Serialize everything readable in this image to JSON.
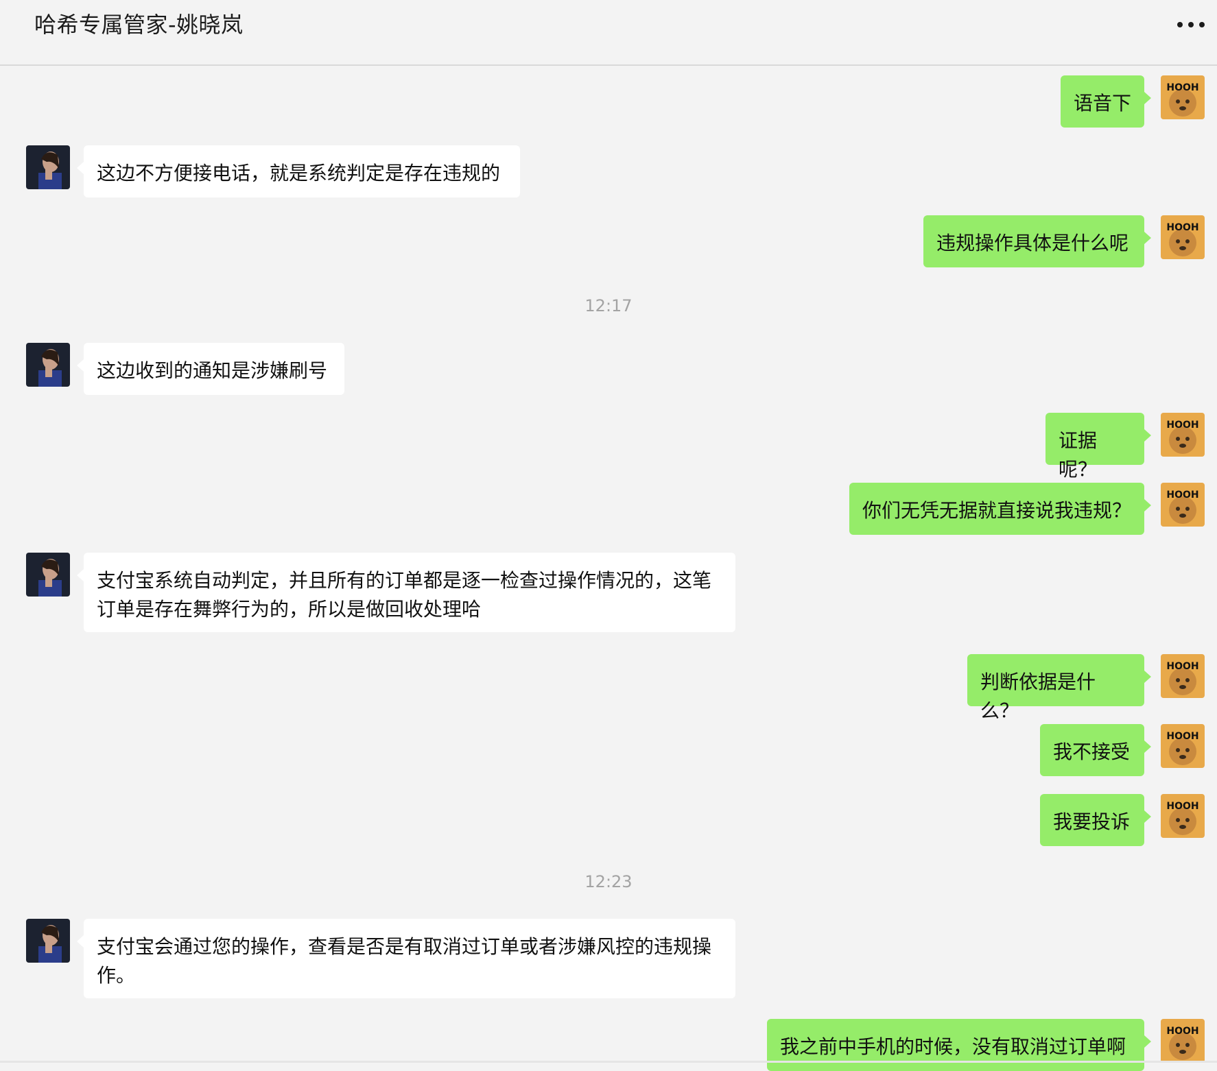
{
  "header": {
    "title": "哈希专属管家-姚晓岚"
  },
  "messages": [
    {
      "side": "out",
      "text": "语音下"
    },
    {
      "side": "in",
      "text": "这边不方便接电话，就是系统判定是存在违规的"
    },
    {
      "side": "out",
      "text": "违规操作具体是什么呢"
    },
    {
      "time": "12:17"
    },
    {
      "side": "in",
      "text": "这边收到的通知是涉嫌刷号"
    },
    {
      "side": "out",
      "text": "证据呢？"
    },
    {
      "side": "out",
      "text": "你们无凭无据就直接说我违规？"
    },
    {
      "side": "in",
      "text": "支付宝系统自动判定，并且所有的订单都是逐一检查过操作情况的，这笔订单是存在舞弊行为的，所以是做回收处理哈"
    },
    {
      "side": "out",
      "text": "判断依据是什么？"
    },
    {
      "side": "out",
      "text": "我不接受"
    },
    {
      "side": "out",
      "text": "我要投诉"
    },
    {
      "time": "12:23"
    },
    {
      "side": "in",
      "text": "支付宝会通过您的操作，查看是否是有取消过订单或者涉嫌风控的违规操作。"
    },
    {
      "side": "out",
      "text": "我之前中手机的时候，没有取消过订单啊"
    }
  ],
  "avatars": {
    "me_badge_text": "HOOH"
  },
  "colors": {
    "outgoing_bubble": "#95ec69",
    "incoming_bubble": "#ffffff",
    "background": "#f3f3f3"
  }
}
